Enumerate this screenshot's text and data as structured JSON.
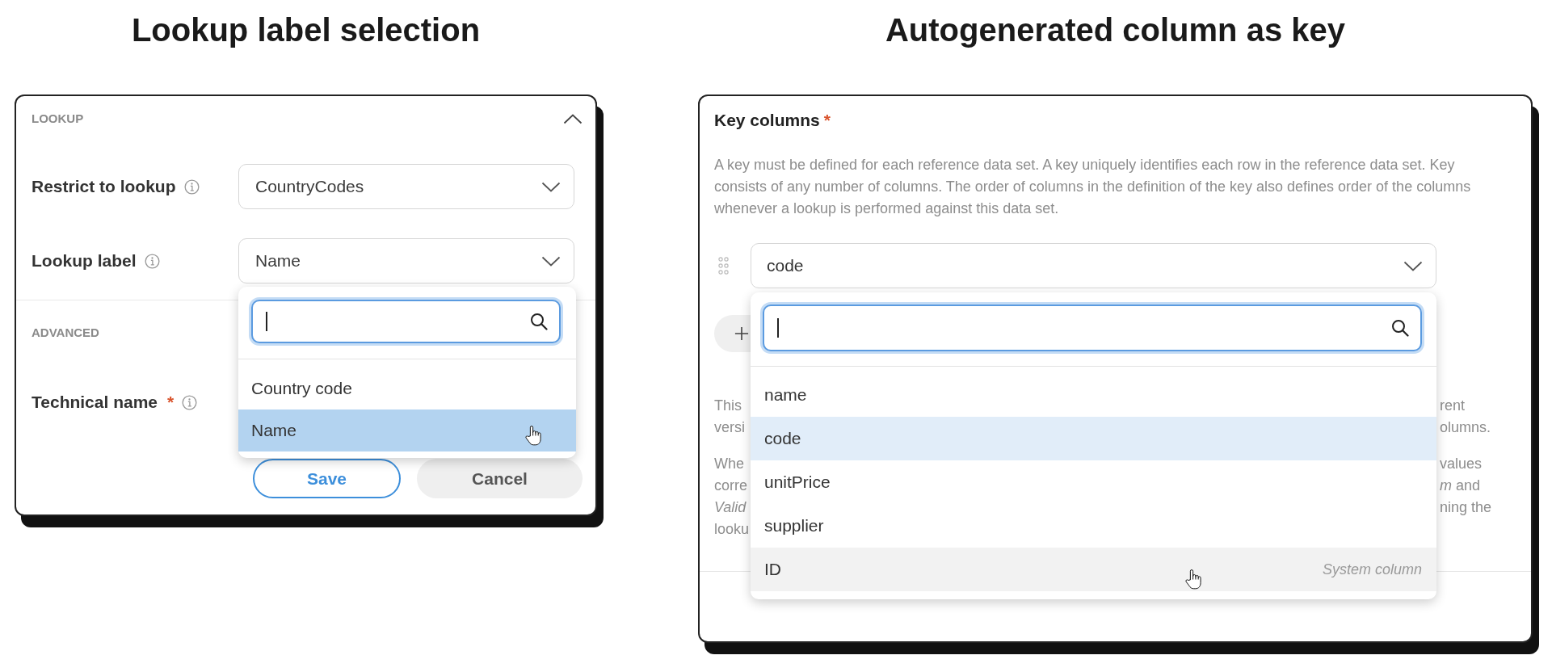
{
  "lookup_example": {
    "heading": "Lookup label selection",
    "lookup_section": {
      "title": "LOOKUP",
      "expanded": true
    },
    "fields": [
      {
        "label": "Restrict to lookup",
        "value": "CountryCodes"
      },
      {
        "label": "Lookup label",
        "value": "Name",
        "dropdown": {
          "search": {
            "focused": true
          },
          "options": [
            {
              "label": "Country code",
              "selected": false,
              "hovered": false
            },
            {
              "label": "Name",
              "selected": true,
              "hovered": true
            }
          ]
        }
      }
    ],
    "advanced_section": {
      "title": "ADVANCED"
    },
    "advanced_fields": [
      {
        "label": "Technical name",
        "required_mark": "*"
      }
    ],
    "buttons": [
      {
        "label": "Save",
        "kind": "primary"
      },
      {
        "label": "Cancel",
        "kind": "secondary"
      }
    ]
  },
  "key_example": {
    "heading": "Autogenerated column as key",
    "title": "Key columns",
    "required_mark": "*",
    "description": "A key must be defined for each reference data set. A key uniquely identifies each row in the reference data set. Key consists of any number of columns. The order of columns in the definition of the key also defines order of the columns whenever a lookup is performed against this data set.",
    "key_fields": [
      {
        "value": "code",
        "dropdown": {
          "search": {
            "focused": true
          },
          "options": [
            {
              "label": "name",
              "selected": false,
              "hovered": false
            },
            {
              "label": "code",
              "selected": true,
              "hovered": false
            },
            {
              "label": "unitPrice",
              "selected": false,
              "hovered": false
            },
            {
              "label": "supplier",
              "selected": false,
              "hovered": false
            },
            {
              "label": "ID",
              "note": "System column",
              "selected": false,
              "hovered": true
            }
          ]
        }
      }
    ],
    "notes": [
      {
        "lines": [
          {
            "left": "This",
            "right": "rent"
          },
          {
            "left": "versi",
            "right": "olumns."
          }
        ]
      },
      {
        "lines": [
          {
            "left": "Whe",
            "right": "values"
          },
          {
            "left": "corre",
            "right": "*m* and"
          },
          {
            "left": "Valid",
            "left_italic": true,
            "right": "ning the"
          },
          {
            "left": "looku"
          }
        ]
      }
    ]
  }
}
